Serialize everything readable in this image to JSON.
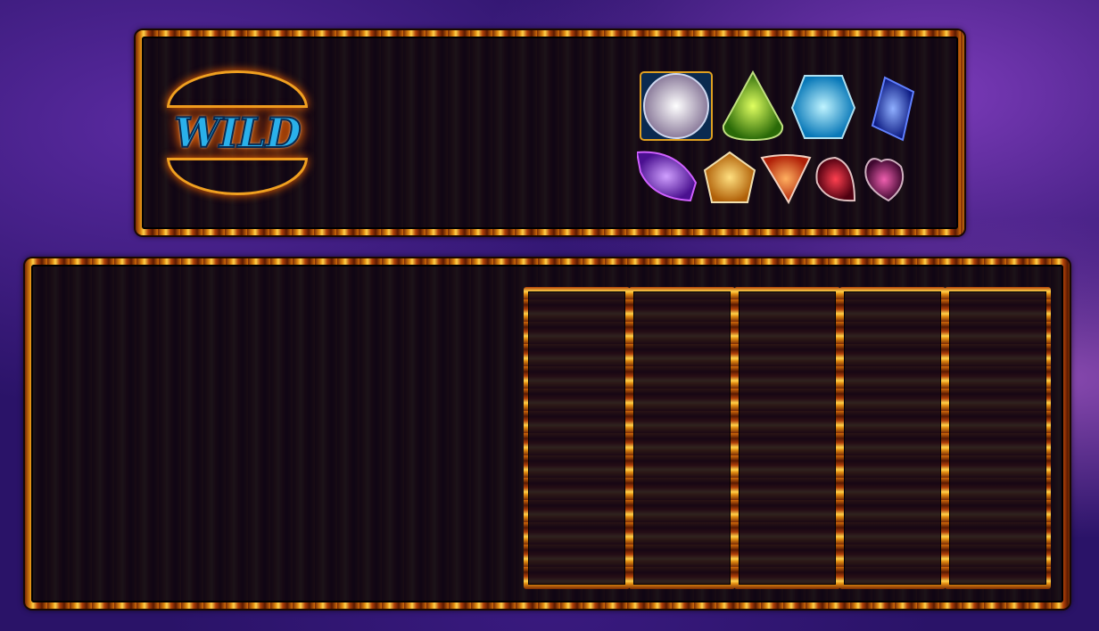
{
  "paytable": {
    "wild_label": "WILD",
    "symbols": [
      {
        "name": "diamond",
        "color": "#e8ecff"
      },
      {
        "name": "peridot",
        "color": "#6ac020"
      },
      {
        "name": "aquamarine",
        "color": "#30c8f0"
      },
      {
        "name": "sapphire",
        "color": "#2048e0"
      },
      {
        "name": "amethyst",
        "color": "#8a40e0"
      },
      {
        "name": "citrine",
        "color": "#f0a020"
      },
      {
        "name": "fire-opal",
        "color": "#f04a10"
      },
      {
        "name": "ruby",
        "color": "#c01020"
      },
      {
        "name": "rhodolite",
        "color": "#a02070"
      }
    ]
  },
  "reels": {
    "count": 5
  }
}
